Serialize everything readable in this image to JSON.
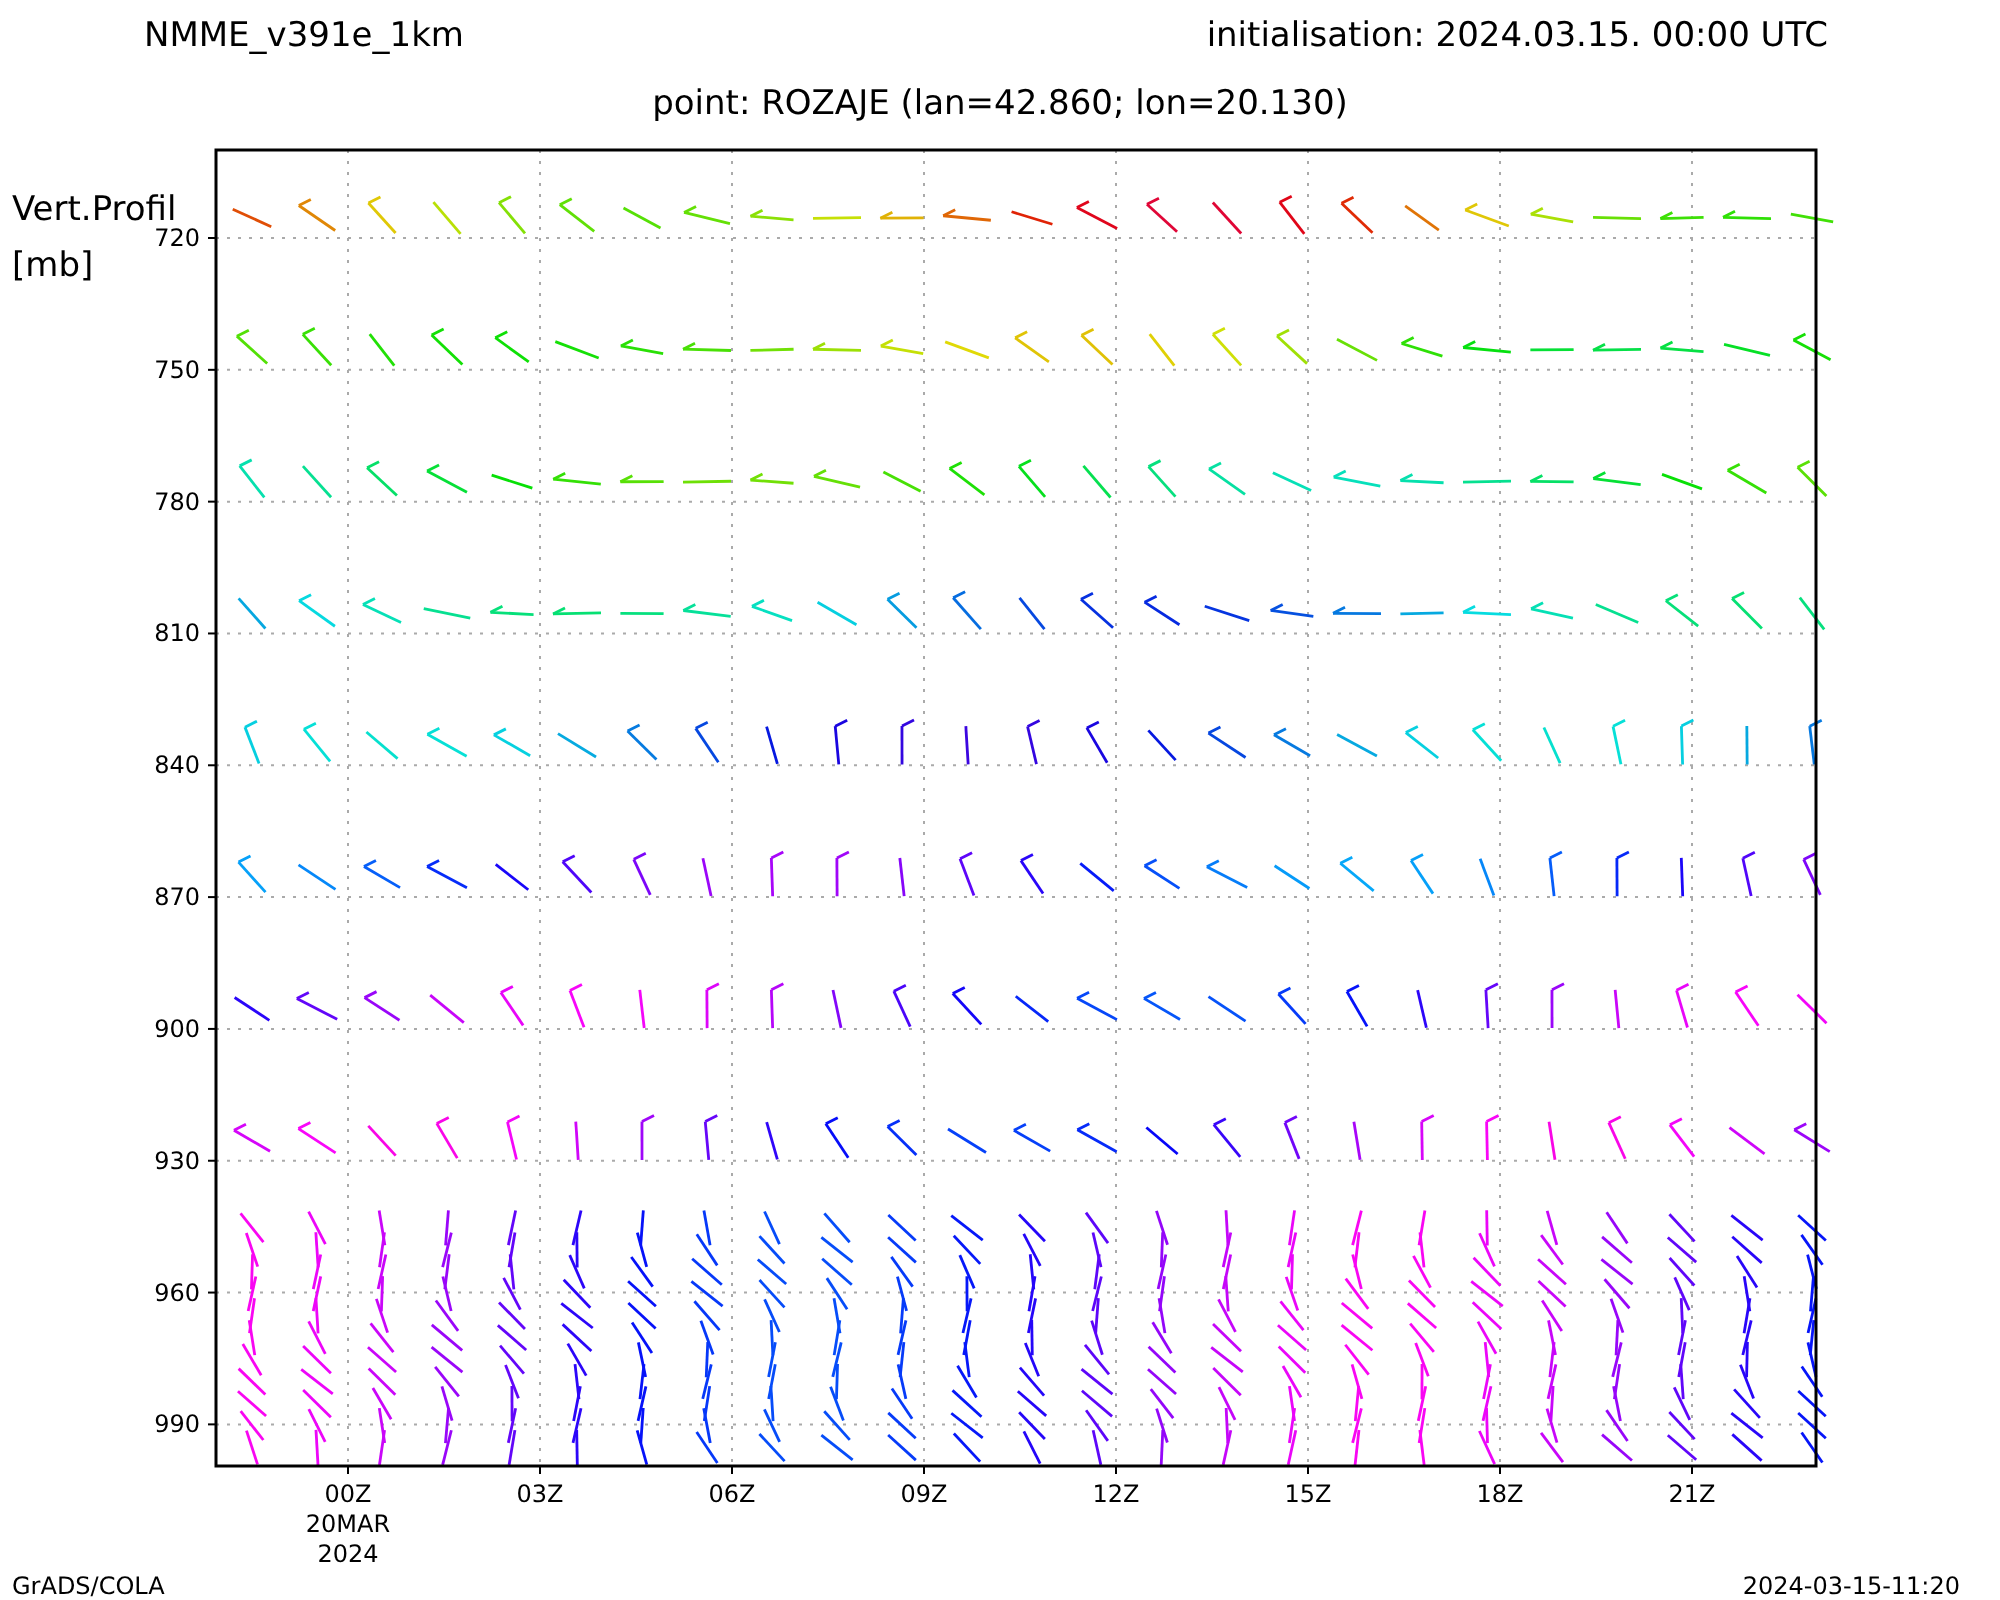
{
  "header": {
    "model": "NMME_v391e_1km",
    "initialisation": "initialisation: 2024.03.15. 00:00 UTC"
  },
  "subtitle": "point: ROZAJE (lan=42.860; lon=20.130)",
  "y_axis": {
    "title": [
      "Vert.Profil",
      "[mb]"
    ],
    "ticks": [
      "720",
      "750",
      "780",
      "810",
      "840",
      "870",
      "900",
      "930",
      "960",
      "990"
    ]
  },
  "x_axis": {
    "ticks": [
      {
        "label": "00Z",
        "sublabels": [
          "20MAR",
          "2024"
        ]
      },
      {
        "label": "03Z"
      },
      {
        "label": "06Z"
      },
      {
        "label": "09Z"
      },
      {
        "label": "12Z"
      },
      {
        "label": "15Z"
      },
      {
        "label": "18Z"
      },
      {
        "label": "21Z"
      }
    ]
  },
  "footer": {
    "left": "GrADS/COLA",
    "right": "2024-03-15-11:20"
  }
}
